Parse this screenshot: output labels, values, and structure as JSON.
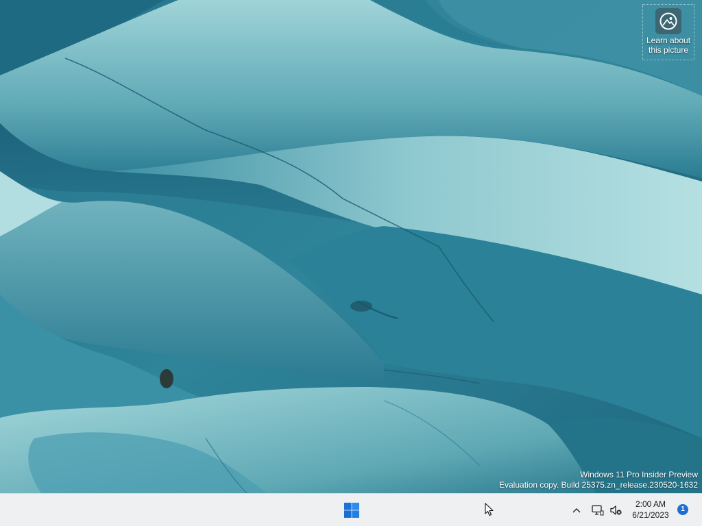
{
  "desktop": {
    "learn_widget": {
      "label": "Learn about\nthis picture",
      "icon": "learn-about-picture-icon"
    },
    "watermark": {
      "line1": "Windows 11 Pro Insider Preview",
      "line2": "Evaluation copy. Build 25375.zn_release.230520-1632"
    }
  },
  "taskbar": {
    "start_icon": "windows-logo-icon",
    "tray": {
      "chevron_icon": "chevron-up-icon",
      "network_icon": "network-icon",
      "volume_icon": "volume-muted-icon"
    },
    "clock": {
      "time": "2:00 AM",
      "date": "6/21/2023"
    },
    "notification_count": "1"
  },
  "colors": {
    "taskbar_bg": "#eef0f2",
    "windows_blue": "#1a73d9",
    "badge_blue": "#1f6fd0",
    "wallpaper_deep": "#1d6a82",
    "wallpaper_light": "#a9dadd"
  }
}
